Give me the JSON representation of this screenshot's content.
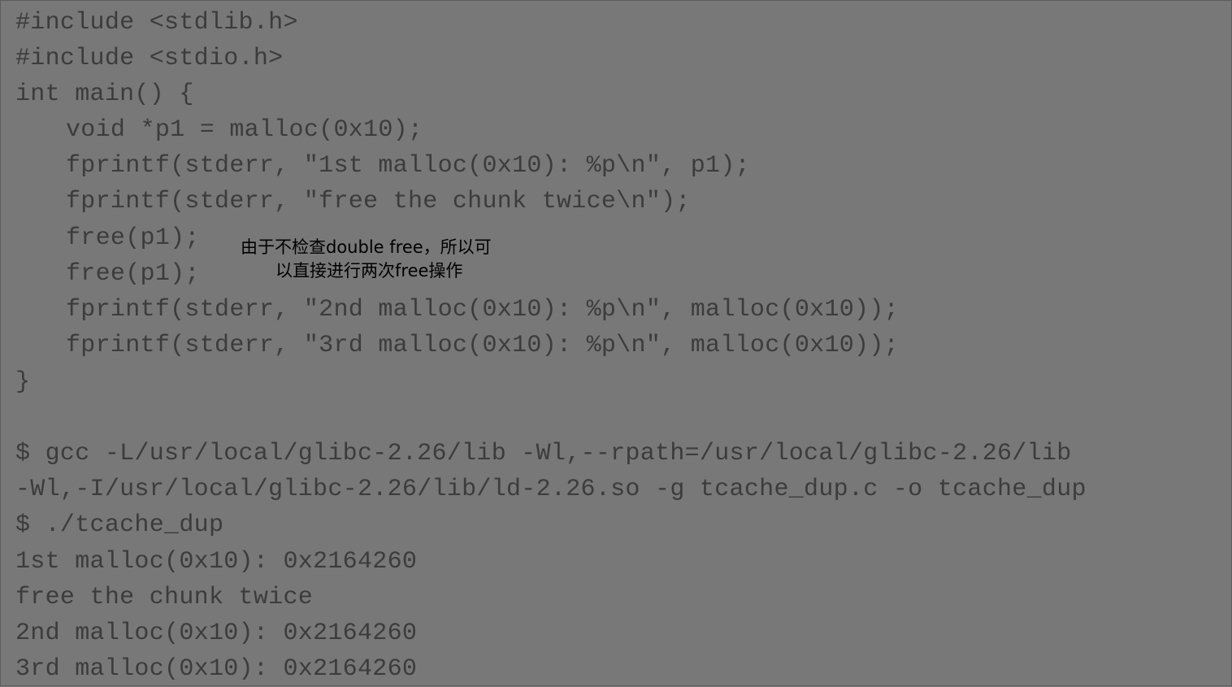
{
  "source_code": {
    "lines": [
      "#include <stdlib.h>",
      "#include <stdio.h>",
      "int main() {",
      "void *p1 = malloc(0x10);",
      "fprintf(stderr, \"1st malloc(0x10): %p\\n\", p1);",
      "fprintf(stderr, \"free the chunk twice\\n\");",
      "free(p1);",
      "free(p1);",
      "fprintf(stderr, \"2nd malloc(0x10): %p\\n\", malloc(0x10));",
      "fprintf(stderr, \"3rd malloc(0x10): %p\\n\", malloc(0x10));",
      "}"
    ]
  },
  "terminal": {
    "lines": [
      "$ gcc -L/usr/local/glibc-2.26/lib -Wl,--rpath=/usr/local/glibc-2.26/lib",
      "-Wl,-I/usr/local/glibc-2.26/lib/ld-2.26.so -g tcache_dup.c -o tcache_dup",
      "$ ./tcache_dup",
      "1st malloc(0x10): 0x2164260",
      "free the chunk twice",
      "2nd malloc(0x10): 0x2164260",
      "3rd malloc(0x10): 0x2164260"
    ]
  },
  "annotation": {
    "line1": "由于不检查double free，所以可",
    "line2": "以直接进行两次free操作"
  },
  "colors": {
    "background": "#777877",
    "code_text": "#3b3c3b",
    "annotation_text": "#000000"
  }
}
